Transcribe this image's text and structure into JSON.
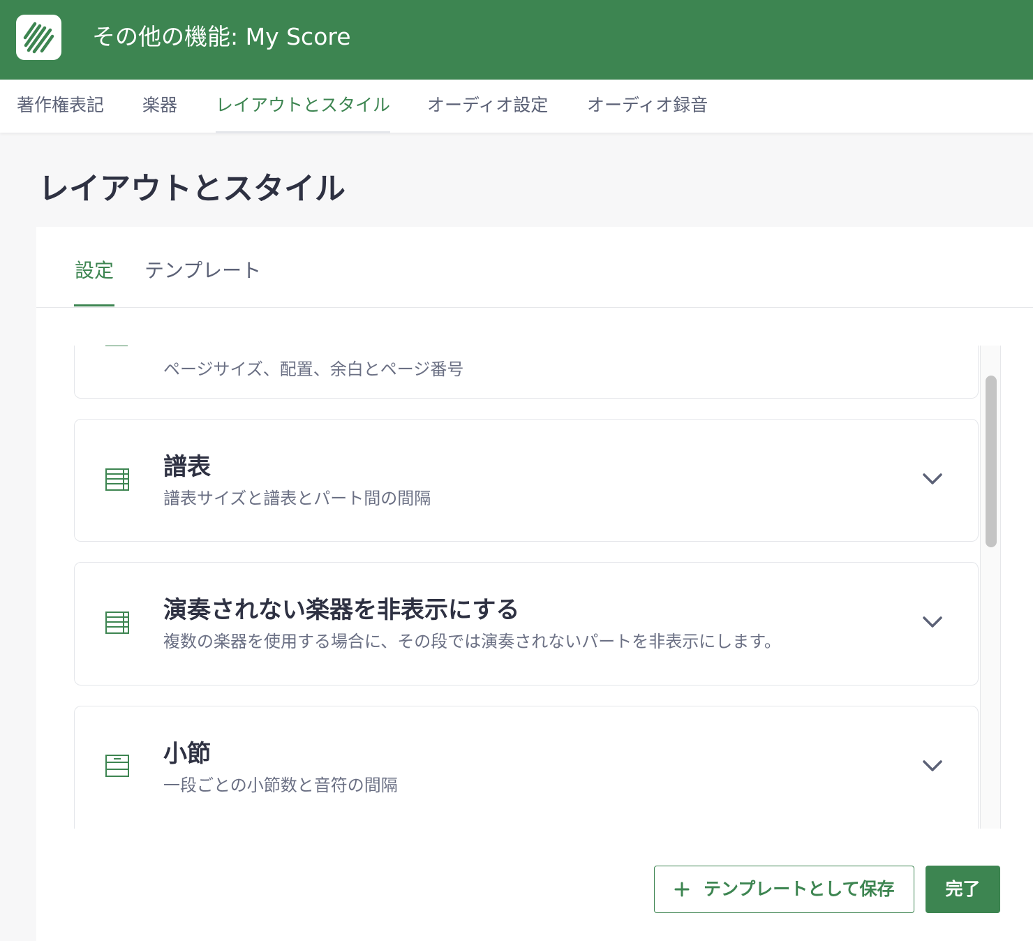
{
  "header": {
    "title": "その他の機能: My Score",
    "logo_icon": "app-logo-icon",
    "background": "#3d8551"
  },
  "topnav": {
    "tabs": [
      {
        "label": "著作権表記",
        "active": false
      },
      {
        "label": "楽器",
        "active": false
      },
      {
        "label": "レイアウトとスタイル",
        "active": true
      },
      {
        "label": "オーディオ設定",
        "active": false
      },
      {
        "label": "オーディオ録音",
        "active": false
      }
    ]
  },
  "page": {
    "title": "レイアウトとスタイル"
  },
  "subtabs": [
    {
      "label": "設定",
      "active": true
    },
    {
      "label": "テンプレート",
      "active": false
    }
  ],
  "sections": [
    {
      "title": "",
      "description": "ページサイズ、配置、余白とページ番号",
      "icon": "page-icon"
    },
    {
      "title": "譜表",
      "description": "譜表サイズと譜表とパート間の間隔",
      "icon": "staff-icon",
      "expand_icon": "chevron-down-icon"
    },
    {
      "title": "演奏されない楽器を非表示にする",
      "description": "複数の楽器を使用する場合に、その段では演奏されないパートを非表示にします。",
      "icon": "staff-icon",
      "expand_icon": "chevron-down-icon"
    },
    {
      "title": "小節",
      "description": "一段ごとの小節数と音符の間隔",
      "icon": "measure-icon",
      "expand_icon": "chevron-down-icon"
    }
  ],
  "footer": {
    "save_template_label": "テンプレートとして保存",
    "save_template_icon": "plus-icon",
    "done_label": "完了"
  },
  "colors": {
    "accent": "#3d8551",
    "text_dark": "#2e3142",
    "text_muted": "#6b7084"
  }
}
